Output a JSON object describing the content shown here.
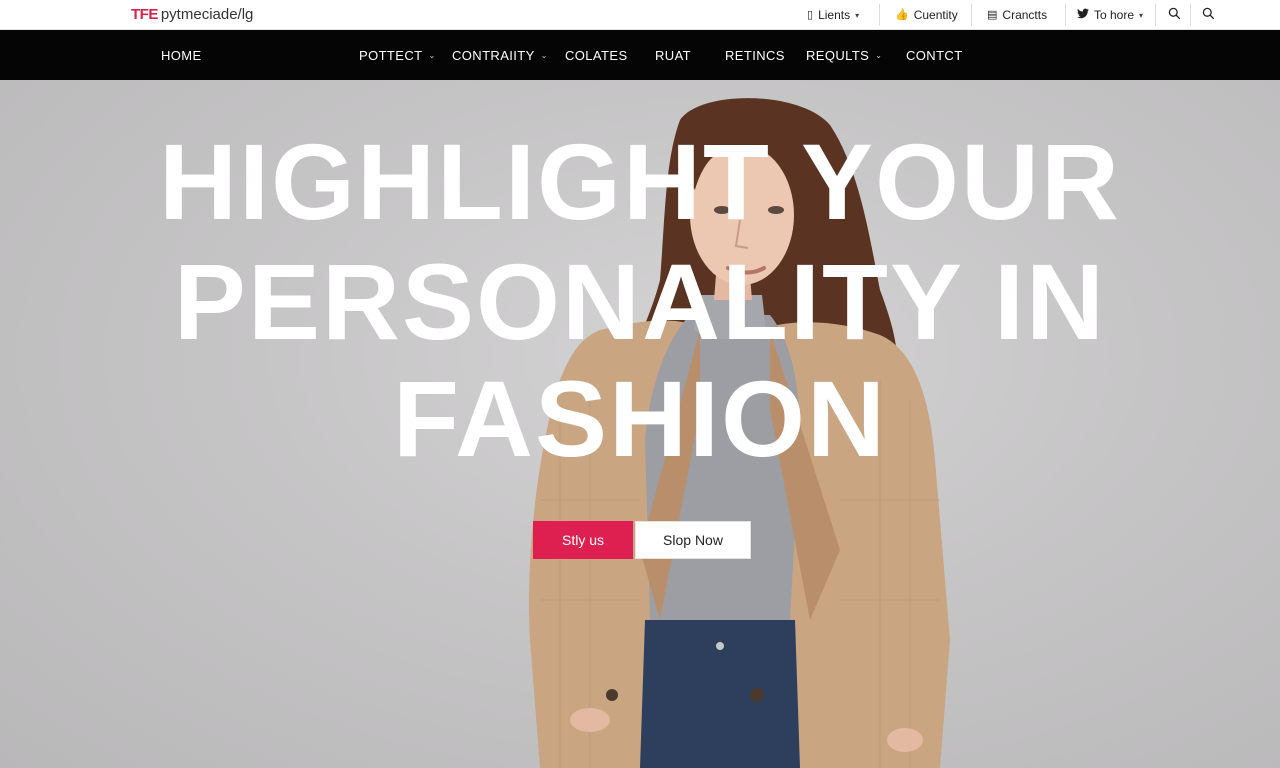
{
  "brand": {
    "mark": "TFE",
    "name": "pytmeciade/lg"
  },
  "utility": {
    "lients": {
      "label": "Lients",
      "icon": "clipboard-icon"
    },
    "cuentity": {
      "label": "Cuentity",
      "icon": "thumbs-up-icon"
    },
    "cranctts": {
      "label": "Cranctts",
      "icon": "chat-icon"
    },
    "to_hore": {
      "label": "To hore",
      "icon": "twitter-icon"
    },
    "search_icon": "search-icon"
  },
  "nav": {
    "items": [
      {
        "label": "HOME",
        "dropdown": false
      },
      {
        "label": "POTTECT",
        "dropdown": true
      },
      {
        "label": "CONTRAIITY",
        "dropdown": true
      },
      {
        "label": "COLATES",
        "dropdown": false
      },
      {
        "label": "RUAT",
        "dropdown": false
      },
      {
        "label": "RETINCS",
        "dropdown": false
      },
      {
        "label": "REQULTS",
        "dropdown": true
      },
      {
        "label": "CONTCT",
        "dropdown": false
      }
    ]
  },
  "hero": {
    "headline_lines": [
      "HIGHLIGHT YOUR",
      "PERSONALITY IN",
      "FASHION"
    ],
    "primary_button": "Stly us",
    "secondary_button": "Slop Now"
  },
  "colors": {
    "accent": "#de2050",
    "nav_bg": "#050505",
    "hero_bg": "#c9c8c9",
    "coat": "#c9a582",
    "sweater": "#9c9ea3",
    "jeans": "#2d3f5c",
    "hair": "#5a3322"
  }
}
